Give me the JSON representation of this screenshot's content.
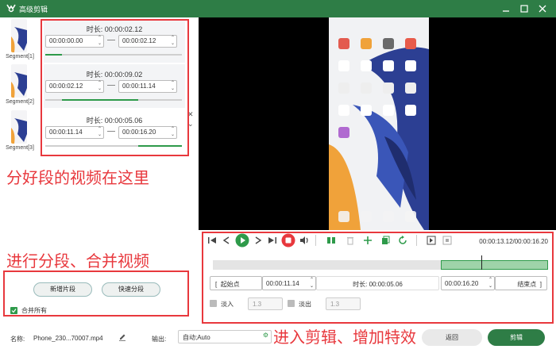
{
  "window": {
    "title": "高级剪辑"
  },
  "segments": [
    {
      "label": "Segment[1]",
      "duration": "时长: 00:00:02.12",
      "start": "00:00:00.00",
      "end": "00:00:02.12",
      "bar_start": 0.0,
      "bar_end": 0.12
    },
    {
      "label": "Segment[2]",
      "duration": "时长: 00:00:09.02",
      "start": "00:00:02.12",
      "end": "00:00:11.14",
      "bar_start": 0.12,
      "bar_end": 0.68
    },
    {
      "label": "Segment[3]",
      "duration": "时长: 00:00:05.06",
      "start": "00:00:11.14",
      "end": "00:00:16.20",
      "bar_start": 0.68,
      "bar_end": 1.0
    }
  ],
  "annotations": {
    "segments_note": "分好段的视频在这里",
    "split_note": "进行分段、合并视频",
    "edit_note": "进入剪辑、增加特效"
  },
  "left_buttons": {
    "add_segment": "新增片段",
    "quick_split": "快速分段",
    "merge_all": "合并所有"
  },
  "player": {
    "time_display": "00:00:13.12/00:00:16.20",
    "progress": 0.8
  },
  "range": {
    "start_point_label": "起始点",
    "start_time": "00:00:11.14",
    "duration": "时长: 00:00:05.06",
    "end_time": "00:00:16.20",
    "end_point_label": "结束点",
    "selection_start": 0.68,
    "selection_end": 1.0
  },
  "fade": {
    "fade_in_label": "淡入",
    "fade_in_value": "1.3",
    "fade_out_label": "淡出",
    "fade_out_value": "1.3"
  },
  "footer": {
    "name_label": "名称:",
    "file_name": "Phone_230...70007.mp4",
    "output_label": "输出:",
    "output_value": "自动;Auto",
    "back_button": "返回",
    "cut_button": "剪辑"
  },
  "colors": {
    "brand": "#2e7d46",
    "annotation": "#e8383d",
    "accent_green": "#2e9a4a",
    "record_red": "#e8383d"
  }
}
